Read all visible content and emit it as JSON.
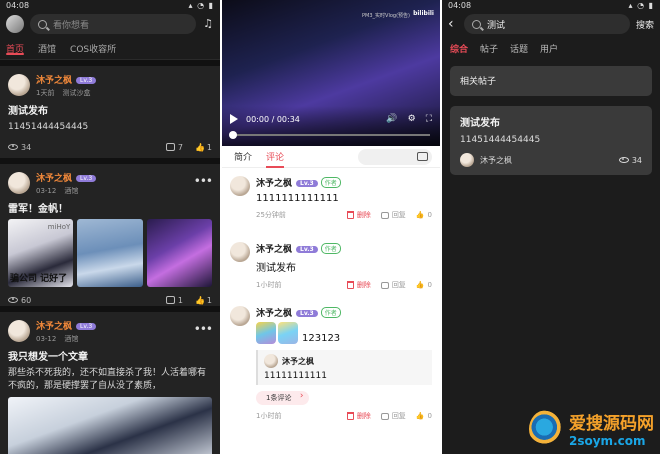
{
  "p1": {
    "status": {
      "time": "04:08",
      "icons": "▴ ◔ ▮"
    },
    "search_placeholder": "看你想看",
    "tabs": [
      "首页",
      "酒馆",
      "COS收容所"
    ],
    "posts": [
      {
        "name": "沐予之枫",
        "level": "Lv.3",
        "time": "1天前",
        "place": "测试沙盒",
        "title": "测试发布",
        "body": "11451444454445",
        "views": "34",
        "comments": "7",
        "likes": "1"
      },
      {
        "name": "沐予之枫",
        "level": "Lv.3",
        "time": "03-12",
        "place": "酒馆",
        "title": "雷军！金帆！",
        "img_caption": "骗公司 记好了",
        "img_watermark": "miHoY",
        "views": "60",
        "comments": "1",
        "likes": "1"
      },
      {
        "name": "沐予之枫",
        "level": "Lv.3",
        "time": "03-12",
        "place": "酒馆",
        "title": "我只想发一个文章",
        "body": "那些杀不死我的，还不如直接杀了我！人活着哪有不疯的，那是硬撑罢了自从没了素质，"
      }
    ]
  },
  "p2": {
    "video": {
      "title": "PM3_实时Vlog(预告)",
      "logo": "bilibili",
      "time": "00:00 / 00:34"
    },
    "tabs": [
      "简介",
      "评论"
    ],
    "comments": [
      {
        "name": "沐予之枫",
        "level": "Lv.3",
        "badge": "作者",
        "text": "1111111111111",
        "time": "25分钟前",
        "delete": "删除",
        "reply": "回复",
        "likes": "0"
      },
      {
        "name": "沐予之枫",
        "level": "Lv.3",
        "badge": "作者",
        "text": "测试发布",
        "time": "1小时前",
        "delete": "删除",
        "reply": "回复",
        "likes": "0"
      },
      {
        "name": "沐予之枫",
        "level": "Lv.3",
        "badge": "作者",
        "text": "123123",
        "quote_name": "沐予之枫",
        "quote_text": "11111111111",
        "replies": "1条评论",
        "time": "1小时前",
        "delete": "删除",
        "reply": "回复",
        "likes": "0"
      }
    ]
  },
  "p3": {
    "status": {
      "time": "04:08",
      "icons": "▴ ◔ ▮"
    },
    "query": "测试",
    "search_button": "搜索",
    "tabs": [
      "综合",
      "帖子",
      "话题",
      "用户"
    ],
    "section_header": "相关帖子",
    "result": {
      "title": "测试发布",
      "body": "11451444454445",
      "author": "沐予之枫",
      "views": "34"
    }
  },
  "watermark": {
    "line1": "爱搜源码网",
    "line2": "2soym.com"
  }
}
